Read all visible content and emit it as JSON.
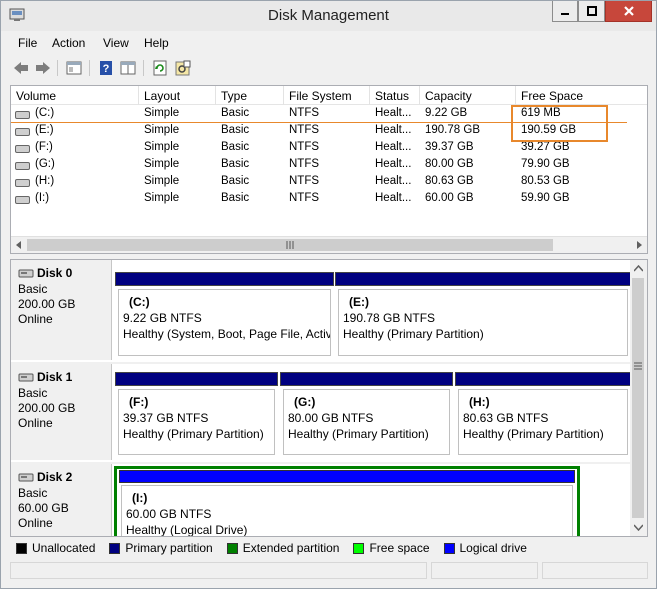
{
  "window": {
    "title": "Disk Management"
  },
  "menu": {
    "items": [
      "File",
      "Action",
      "View",
      "Help"
    ]
  },
  "toolbar": {
    "icons": [
      "back-arrow-icon",
      "forward-arrow-icon",
      "properties-icon",
      "help-icon",
      "pane-icon",
      "refresh-icon",
      "settings-icon"
    ]
  },
  "volume_list": {
    "columns": [
      "Volume",
      "Layout",
      "Type",
      "File System",
      "Status",
      "Capacity",
      "Free Space"
    ],
    "rows": [
      {
        "volume": "(C:)",
        "layout": "Simple",
        "type": "Basic",
        "fs": "NTFS",
        "status": "Healt...",
        "capacity": "9.22 GB",
        "free": "619 MB"
      },
      {
        "volume": "(E:)",
        "layout": "Simple",
        "type": "Basic",
        "fs": "NTFS",
        "status": "Healt...",
        "capacity": "190.78 GB",
        "free": "190.59 GB"
      },
      {
        "volume": "(F:)",
        "layout": "Simple",
        "type": "Basic",
        "fs": "NTFS",
        "status": "Healt...",
        "capacity": "39.37 GB",
        "free": "39.27 GB"
      },
      {
        "volume": "(G:)",
        "layout": "Simple",
        "type": "Basic",
        "fs": "NTFS",
        "status": "Healt...",
        "capacity": "80.00 GB",
        "free": "79.90 GB"
      },
      {
        "volume": "(H:)",
        "layout": "Simple",
        "type": "Basic",
        "fs": "NTFS",
        "status": "Healt...",
        "capacity": "80.63 GB",
        "free": "80.53 GB"
      },
      {
        "volume": "(I:)",
        "layout": "Simple",
        "type": "Basic",
        "fs": "NTFS",
        "status": "Healt...",
        "capacity": "60.00 GB",
        "free": "59.90 GB"
      }
    ]
  },
  "disks": [
    {
      "name": "Disk 0",
      "type": "Basic",
      "size": "200.00 GB",
      "state": "Online",
      "partitions": [
        {
          "name": "(C:)",
          "size": "9.22 GB NTFS",
          "status": "Healthy (System, Boot, Page File, Activ"
        },
        {
          "name": "(E:)",
          "size": "190.78 GB NTFS",
          "status": "Healthy (Primary Partition)"
        }
      ]
    },
    {
      "name": "Disk 1",
      "type": "Basic",
      "size": "200.00 GB",
      "state": "Online",
      "partitions": [
        {
          "name": "(F:)",
          "size": "39.37 GB NTFS",
          "status": "Healthy (Primary Partition)"
        },
        {
          "name": "(G:)",
          "size": "80.00 GB NTFS",
          "status": "Healthy (Primary Partition)"
        },
        {
          "name": "(H:)",
          "size": "80.63 GB NTFS",
          "status": "Healthy (Primary Partition)"
        }
      ]
    },
    {
      "name": "Disk 2",
      "type": "Basic",
      "size": "60.00 GB",
      "state": "Online",
      "partitions": [
        {
          "name": "(I:)",
          "size": "60.00 GB NTFS",
          "status": "Healthy (Logical Drive)"
        }
      ]
    }
  ],
  "legend": [
    {
      "label": "Unallocated",
      "color": "#000000"
    },
    {
      "label": "Primary partition",
      "color": "#000080"
    },
    {
      "label": "Extended partition",
      "color": "#008000"
    },
    {
      "label": "Free space",
      "color": "#00ff00"
    },
    {
      "label": "Logical drive",
      "color": "#0000ff"
    }
  ],
  "colors": {
    "highlight": "#e8882c",
    "close_button": "#c7473b"
  }
}
